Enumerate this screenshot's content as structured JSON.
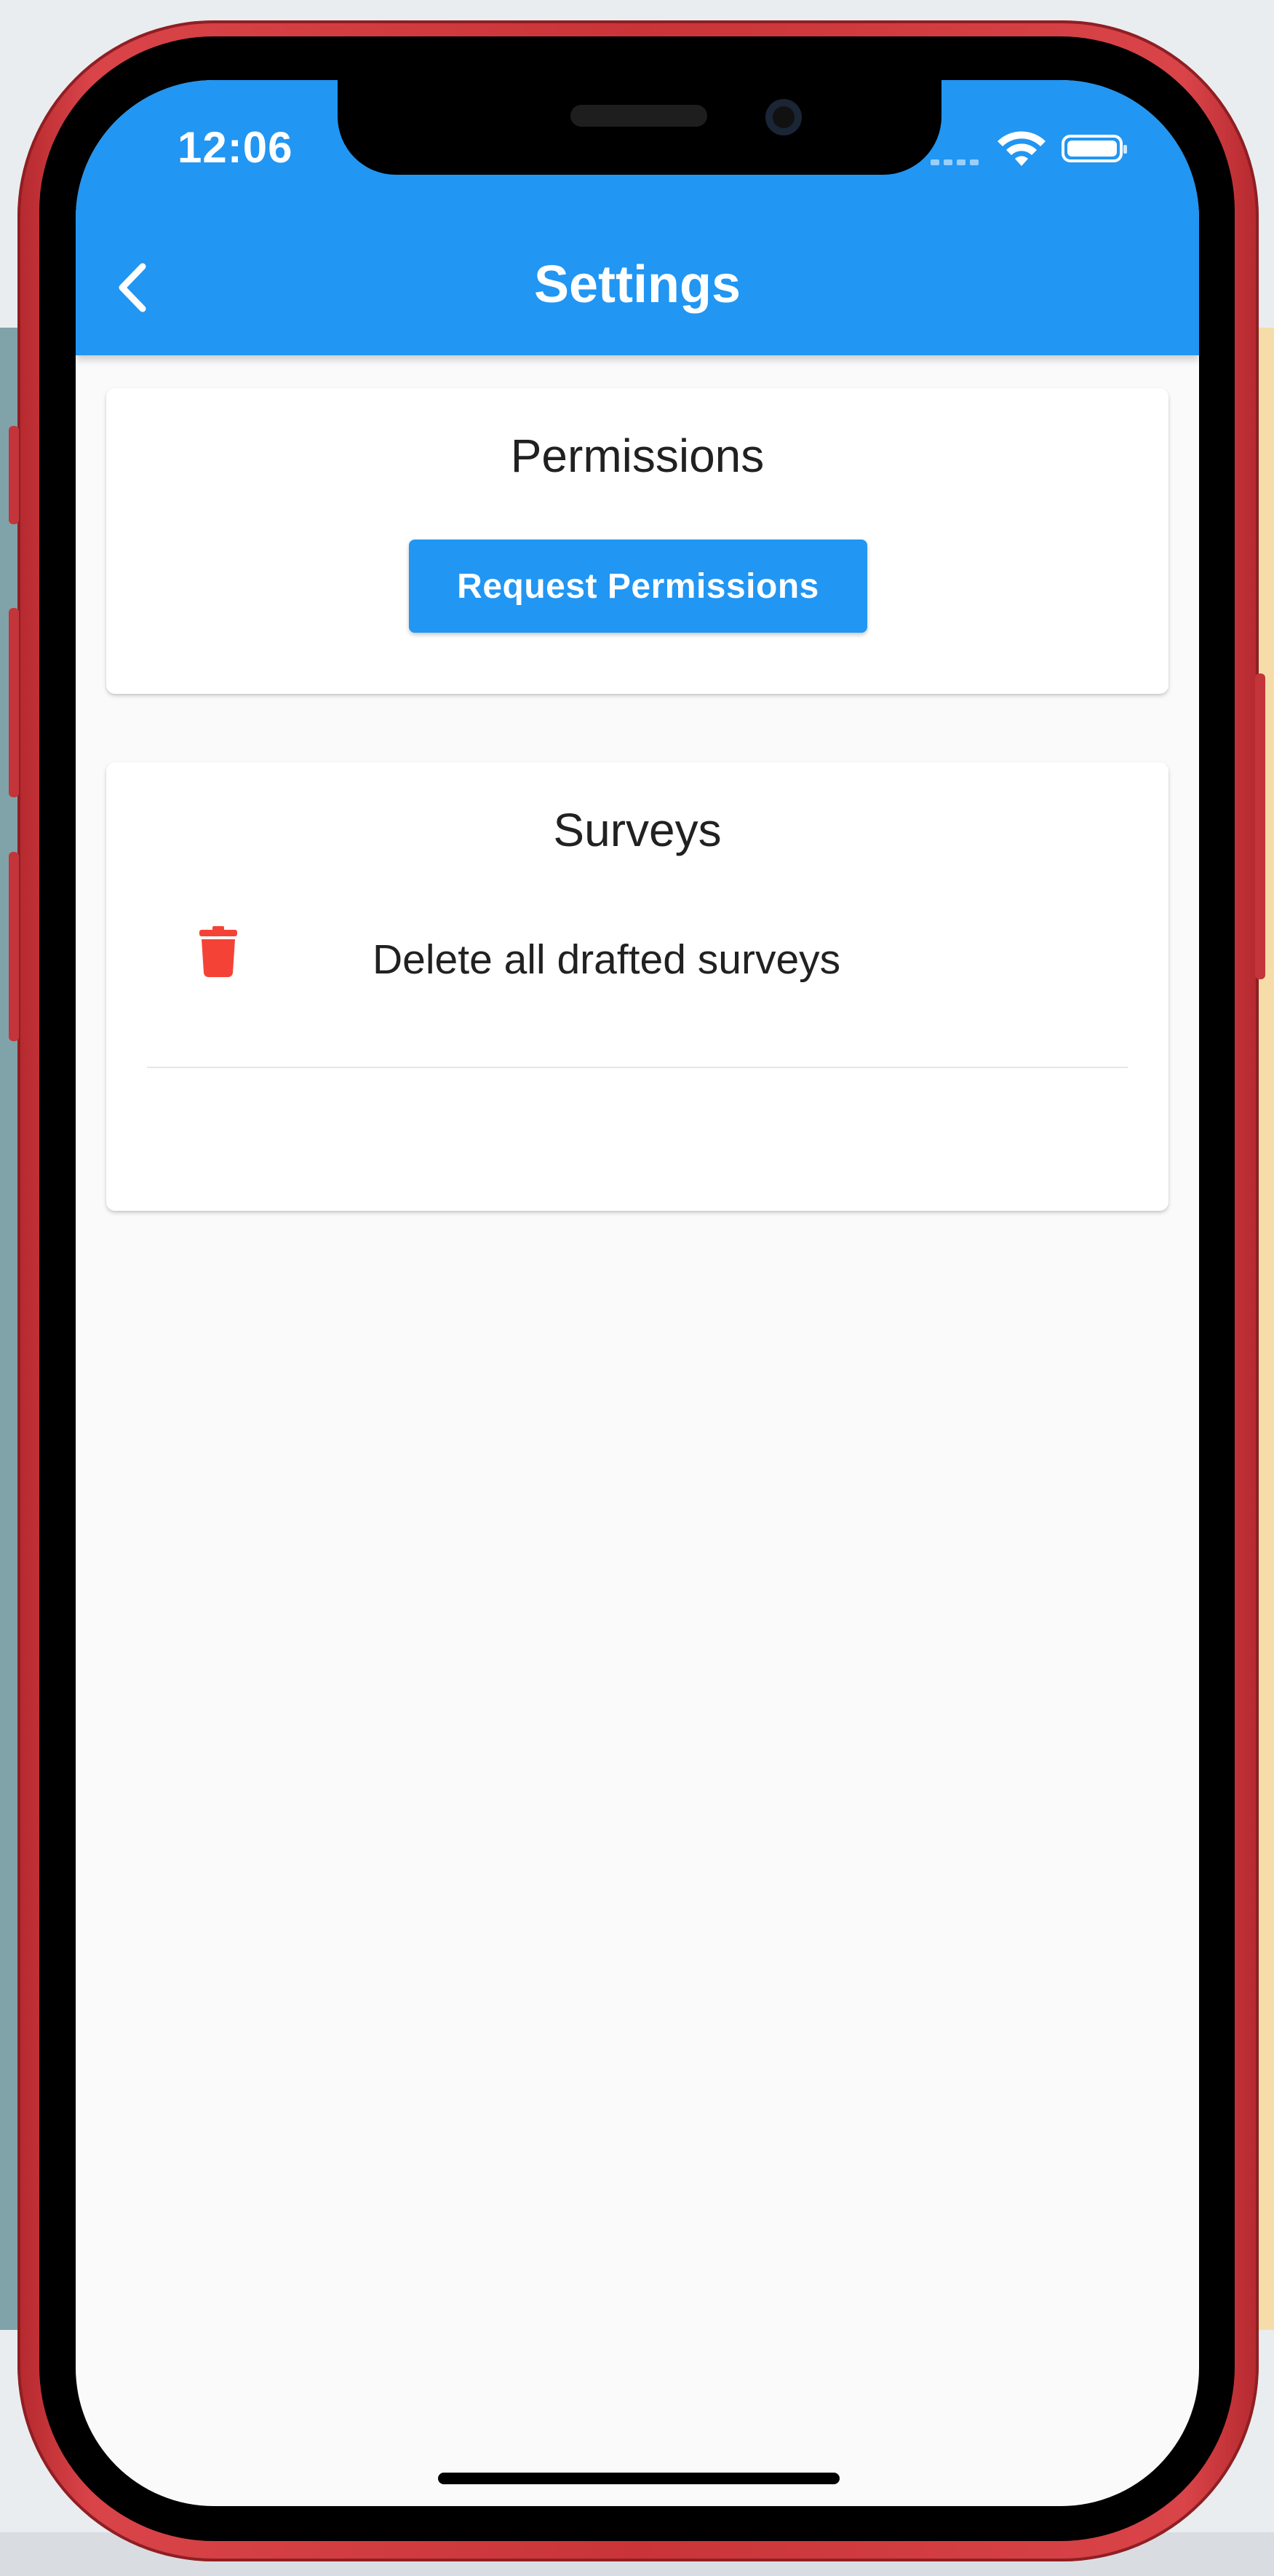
{
  "status_bar": {
    "time": "12:06"
  },
  "app_bar": {
    "title": "Settings",
    "back_icon": "chevron-left-icon",
    "color": "#2196f3"
  },
  "permissions_card": {
    "title": "Permissions",
    "button_label": "Request Permissions"
  },
  "surveys_card": {
    "title": "Surveys",
    "items": [
      {
        "label": "Delete all drafted surveys",
        "icon": "trash-icon",
        "icon_color": "#f44336"
      }
    ]
  }
}
